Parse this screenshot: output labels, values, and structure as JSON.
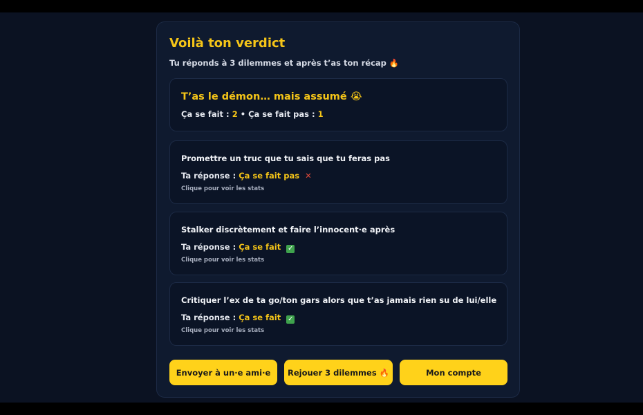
{
  "header": {
    "title": "Voilà ton verdict",
    "subtitle": "Tu réponds à 3 dilemmes et après t’as ton récap 🔥"
  },
  "summary": {
    "verdict": "T’as le démon… mais assumé 😭",
    "yes_label": "Ça se fait :",
    "yes_count": "2",
    "separator": "•",
    "no_label": "Ça se fait pas :",
    "no_count": "1"
  },
  "answer_prefix": "Ta réponse :",
  "hint": "Clique pour voir les stats",
  "questions": [
    {
      "text": "Promettre un truc que tu sais que tu feras pas",
      "answer": "Ça se fait pas",
      "mark": "✕"
    },
    {
      "text": "Stalker discrètement et faire l’innocent·e après",
      "answer": "Ça se fait",
      "mark": "✓"
    },
    {
      "text": "Critiquer l’ex de ta go/ton gars alors que t’as jamais rien su de lui/elle",
      "answer": "Ça se fait",
      "mark": "✓"
    }
  ],
  "buttons": {
    "send": "Envoyer à un·e ami·e",
    "replay": "Rejouer 3 dilemmes 🔥",
    "account": "Mon compte"
  },
  "colors": {
    "accent": "#f5c518",
    "button": "#ffd21a",
    "no_mark": "#e34b3b",
    "yes_mark": "#3fa34d",
    "background": "#0b1222",
    "card": "#0f1a2f"
  }
}
